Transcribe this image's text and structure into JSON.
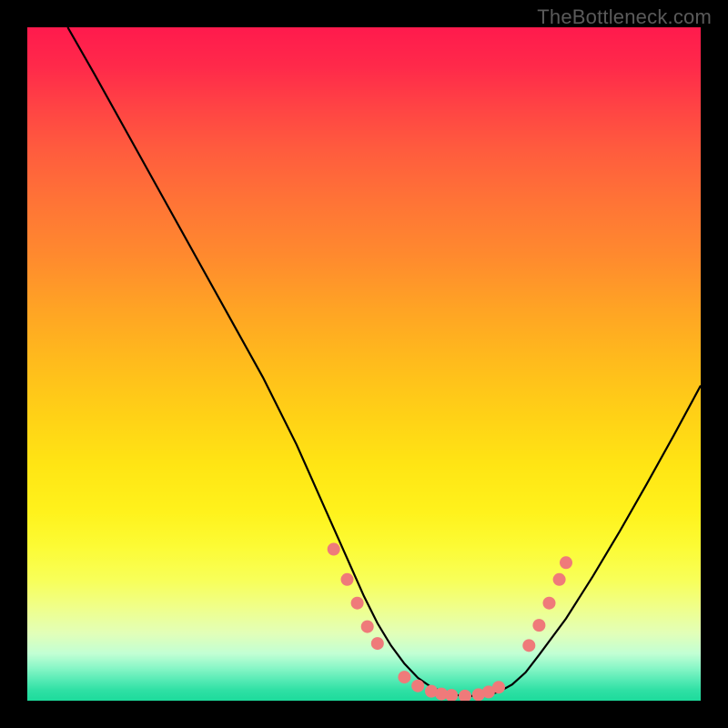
{
  "watermark": "TheBottleneck.com",
  "colors": {
    "background": "#000000",
    "curve": "#000000",
    "marker_fill": "#ef7a7a",
    "marker_stroke": "#d95f5f"
  },
  "chart_data": {
    "type": "line",
    "title": "",
    "xlabel": "",
    "ylabel": "",
    "xlim": [
      0,
      100
    ],
    "ylim": [
      0,
      100
    ],
    "grid": false,
    "series": [
      {
        "name": "bottleneck_curve",
        "x": [
          6,
          10,
          15,
          20,
          25,
          30,
          35,
          40,
          42,
          44,
          46,
          48,
          50,
          52,
          54,
          56,
          58,
          60,
          62,
          64,
          66,
          68,
          70,
          72,
          74,
          76,
          80,
          84,
          88,
          92,
          96,
          100
        ],
        "y": [
          100,
          93,
          84,
          75,
          66,
          57,
          48,
          38,
          33.5,
          29,
          24.5,
          20,
          15.5,
          11.5,
          8.2,
          5.5,
          3.4,
          2.0,
          1.2,
          0.8,
          0.7,
          0.8,
          1.3,
          2.4,
          4.2,
          6.8,
          12.2,
          18.5,
          25.2,
          32.2,
          39.4,
          46.8
        ]
      }
    ],
    "markers": [
      {
        "x": 45.5,
        "y": 22.5
      },
      {
        "x": 47.5,
        "y": 18.0
      },
      {
        "x": 49.0,
        "y": 14.5
      },
      {
        "x": 50.5,
        "y": 11.0
      },
      {
        "x": 52.0,
        "y": 8.5
      },
      {
        "x": 56.0,
        "y": 3.5
      },
      {
        "x": 58.0,
        "y": 2.2
      },
      {
        "x": 60.0,
        "y": 1.4
      },
      {
        "x": 61.5,
        "y": 1.0
      },
      {
        "x": 63.0,
        "y": 0.8
      },
      {
        "x": 65.0,
        "y": 0.7
      },
      {
        "x": 67.0,
        "y": 0.9
      },
      {
        "x": 68.5,
        "y": 1.3
      },
      {
        "x": 70.0,
        "y": 2.0
      },
      {
        "x": 74.5,
        "y": 8.2
      },
      {
        "x": 76.0,
        "y": 11.2
      },
      {
        "x": 77.5,
        "y": 14.5
      },
      {
        "x": 79.0,
        "y": 18.0
      },
      {
        "x": 80.0,
        "y": 20.5
      }
    ]
  }
}
